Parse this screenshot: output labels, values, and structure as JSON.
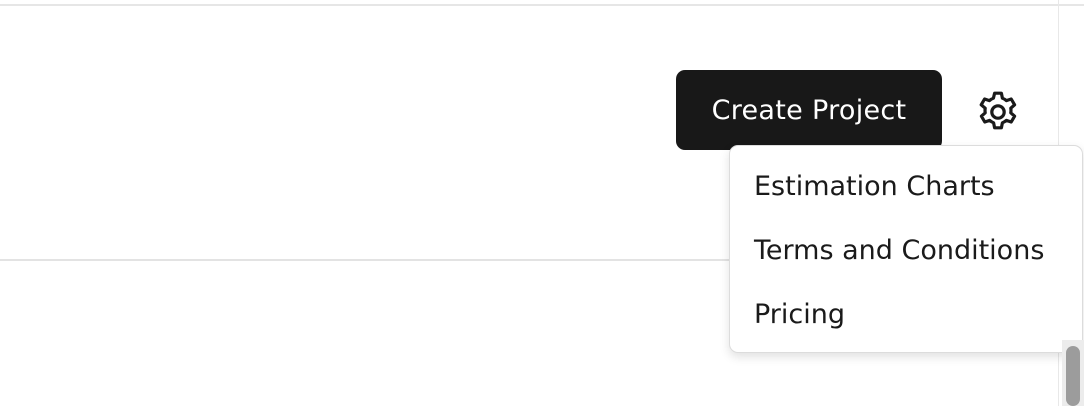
{
  "header": {
    "create_label": "Create Project",
    "settings_icon": "gear-icon"
  },
  "settings_menu": {
    "items": [
      {
        "label": "Estimation Charts"
      },
      {
        "label": "Terms and Conditions"
      },
      {
        "label": "Pricing"
      }
    ]
  },
  "colors": {
    "button_bg": "#181818",
    "button_text": "#ffffff",
    "menu_text": "#1a1a1a",
    "divider": "#e3e3e3"
  }
}
